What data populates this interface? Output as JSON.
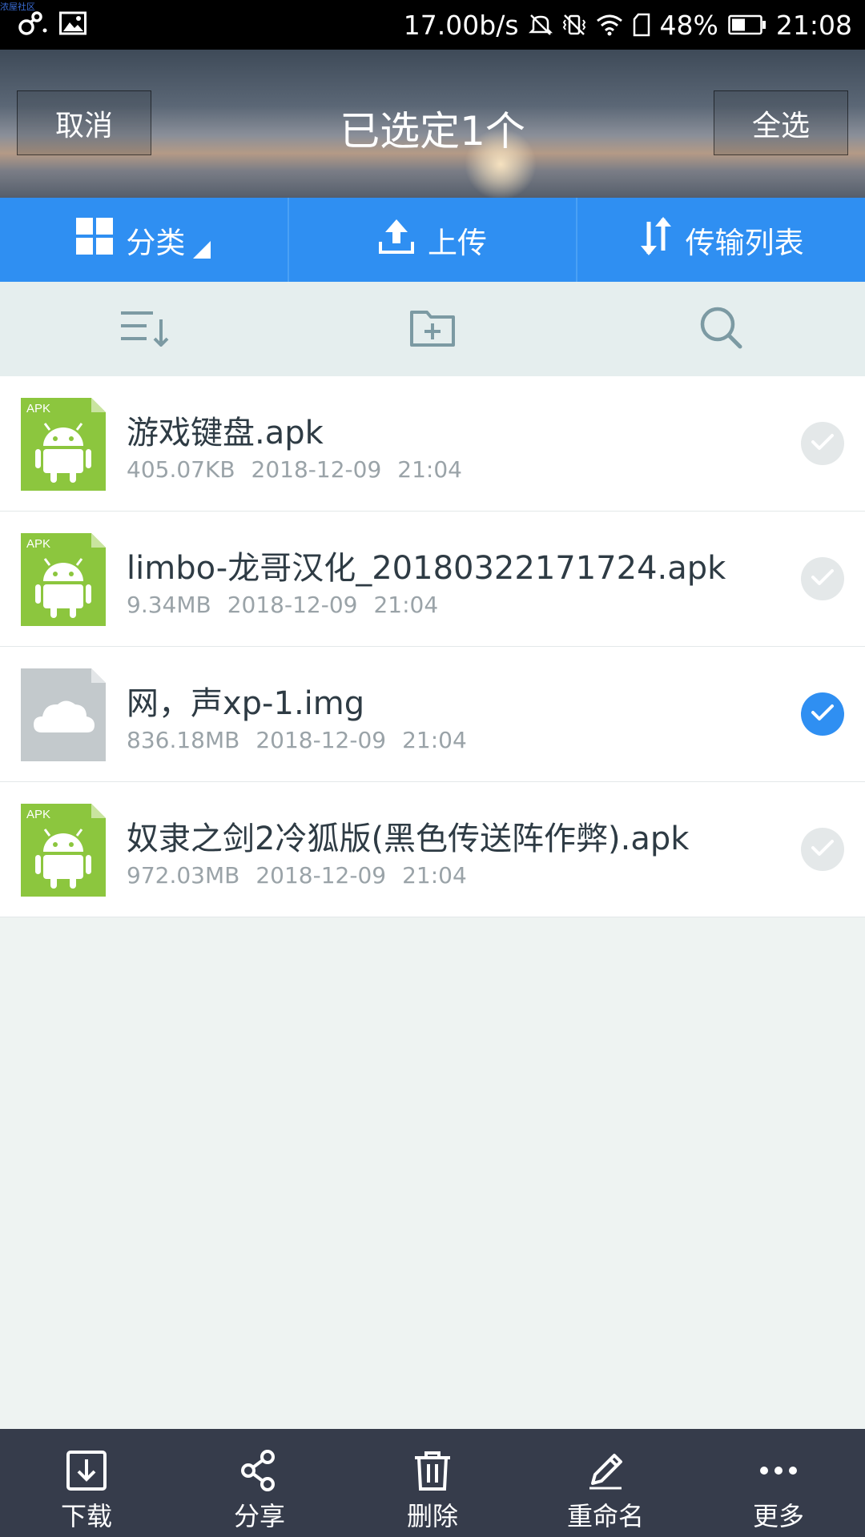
{
  "watermark": "浓屋社区",
  "status_bar": {
    "net_speed": "17.00b/s",
    "battery_percent": "48%",
    "time": "21:08",
    "icons": [
      "link-icon",
      "image-icon",
      "mute-icon",
      "vibrate-off-icon",
      "wifi-icon",
      "sim-icon",
      "battery-icon"
    ]
  },
  "header": {
    "cancel_label": "取消",
    "title": "已选定1个",
    "select_all_label": "全选"
  },
  "tabs": [
    {
      "label": "分类",
      "icon": "grid-icon"
    },
    {
      "label": "上传",
      "icon": "upload-icon"
    },
    {
      "label": "传输列表",
      "icon": "transfer-icon"
    }
  ],
  "tools": [
    "sort-icon",
    "new-folder-icon",
    "search-icon"
  ],
  "files": [
    {
      "name": "游戏键盘.apk",
      "size": "405.07KB",
      "date": "2018-12-09",
      "time": "21:04",
      "type": "apk",
      "type_label": "APK",
      "selected": false
    },
    {
      "name": "limbo-龙哥汉化_20180322171724.apk",
      "size": "9.34MB",
      "date": "2018-12-09",
      "time": "21:04",
      "type": "apk",
      "type_label": "APK",
      "selected": false
    },
    {
      "name": "网，声xp-1.img",
      "size": "836.18MB",
      "date": "2018-12-09",
      "time": "21:04",
      "type": "cloud",
      "type_label": "",
      "selected": true
    },
    {
      "name": "奴隶之剑2冷狐版(黑色传送阵作弊).apk",
      "size": "972.03MB",
      "date": "2018-12-09",
      "time": "21:04",
      "type": "apk",
      "type_label": "APK",
      "selected": false
    }
  ],
  "actions": [
    {
      "label": "下载",
      "icon": "download-icon"
    },
    {
      "label": "分享",
      "icon": "share-icon"
    },
    {
      "label": "删除",
      "icon": "trash-icon"
    },
    {
      "label": "重命名",
      "icon": "pencil-icon"
    },
    {
      "label": "更多",
      "icon": "more-icon"
    }
  ],
  "colors": {
    "accent": "#2f8ff2",
    "apk_green": "#8cc63e",
    "action_bar": "#363c4b",
    "background": "#eef3f2"
  }
}
